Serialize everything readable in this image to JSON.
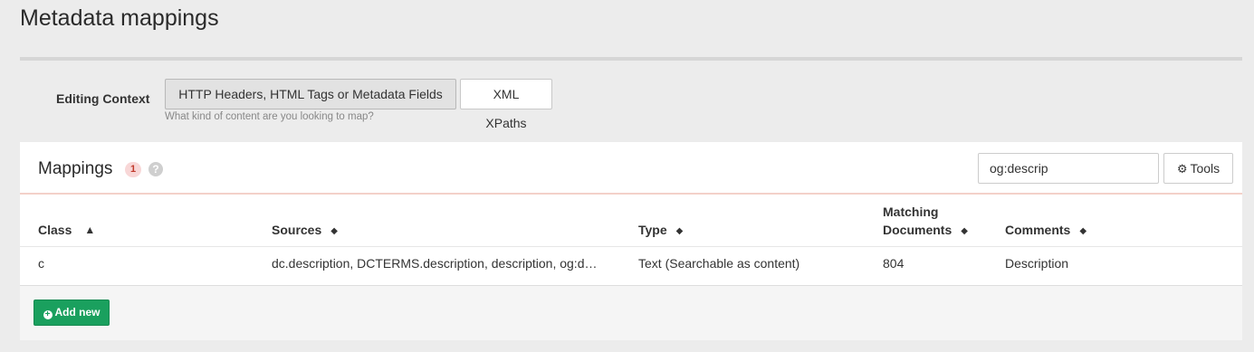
{
  "page": {
    "title": "Metadata mappings"
  },
  "context": {
    "label": "Editing Context",
    "options": [
      {
        "label": "HTTP Headers, HTML Tags or Metadata Fields",
        "active": true
      },
      {
        "label": "XML XPaths",
        "active": false
      }
    ],
    "help": "What kind of content are you looking to map?"
  },
  "mappings": {
    "title": "Mappings",
    "count": "1",
    "help_icon": "?",
    "search": {
      "value": "og:descrip",
      "placeholder": ""
    },
    "tools_label": "Tools",
    "columns": [
      {
        "label": "Class",
        "sort": "ascending"
      },
      {
        "label": "Sources",
        "sort": "none"
      },
      {
        "label": "Type",
        "sort": "none"
      },
      {
        "label_line1": "Matching",
        "label_line2": "Documents",
        "sort": "none"
      },
      {
        "label": "Comments",
        "sort": "none"
      }
    ],
    "rows": [
      {
        "class": "c",
        "sources": "dc.description, DCTERMS.description, description, og:d…",
        "type": "Text (Searchable as content)",
        "matching_documents": "804",
        "comments": "Description"
      }
    ],
    "add_label": "Add new"
  },
  "colors": {
    "accent_green": "#1aa05e",
    "badge_red": "#c0392b",
    "header_underline": "#f3d1c9"
  },
  "icons": {
    "sort_ascending": "sort-ascending-icon",
    "sort_both": "sort-icon",
    "gear": "gear-icon",
    "plus_circle": "plus-circle-icon",
    "help": "question-circle-icon"
  }
}
